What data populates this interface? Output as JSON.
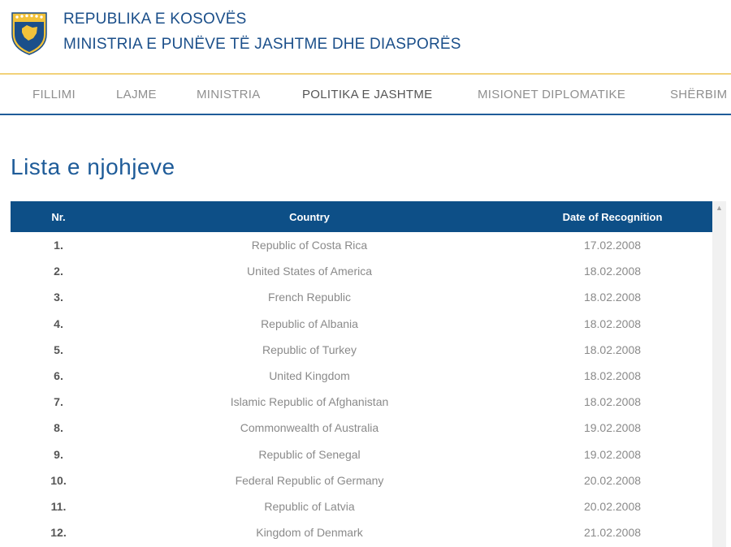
{
  "header": {
    "line1": "REPUBLIKA E KOSOVËS",
    "line2": "MINISTRIA E PUNËVE TË JASHTME DHE DIASPORËS"
  },
  "nav": {
    "items": [
      {
        "label": "FILLIMI"
      },
      {
        "label": "LAJME"
      },
      {
        "label": "MINISTRIA"
      },
      {
        "label": "POLITIKA E JASHTME"
      },
      {
        "label": "MISIONET DIPLOMATIKE"
      },
      {
        "label": "SHËRBIM"
      }
    ],
    "active_label": "POLITIKA E JASHTME"
  },
  "page": {
    "title": "Lista e njohjeve"
  },
  "table": {
    "headers": {
      "nr": "Nr.",
      "country": "Country",
      "date": "Date of Recognition"
    },
    "rows": [
      {
        "nr": "1.",
        "country": "Republic of Costa Rica",
        "date": "17.02.2008"
      },
      {
        "nr": "2.",
        "country": "United States of America",
        "date": "18.02.2008"
      },
      {
        "nr": "3.",
        "country": "French Republic",
        "date": "18.02.2008"
      },
      {
        "nr": "4.",
        "country": "Republic of Albania",
        "date": "18.02.2008"
      },
      {
        "nr": "5.",
        "country": "Republic of Turkey",
        "date": "18.02.2008"
      },
      {
        "nr": "6.",
        "country": "United Kingdom",
        "date": "18.02.2008"
      },
      {
        "nr": "7.",
        "country": "Islamic Republic of Afghanistan",
        "date": "18.02.2008"
      },
      {
        "nr": "8.",
        "country": "Commonwealth of Australia",
        "date": "19.02.2008"
      },
      {
        "nr": "9.",
        "country": "Republic of Senegal",
        "date": "19.02.2008"
      },
      {
        "nr": "10.",
        "country": "Federal Republic of Germany",
        "date": "20.02.2008"
      },
      {
        "nr": "11.",
        "country": "Republic of Latvia",
        "date": "20.02.2008"
      },
      {
        "nr": "12.",
        "country": "Kingdom of Denmark",
        "date": "21.02.2008"
      }
    ]
  },
  "icons": {
    "emblem": "kosovo-coat-of-arms-icon",
    "scroll_up": "scroll-up-arrow-icon"
  },
  "colors": {
    "brand_blue": "#1b4f8a",
    "table_header": "#0d4f87",
    "gold_rule": "#f2d27a"
  }
}
